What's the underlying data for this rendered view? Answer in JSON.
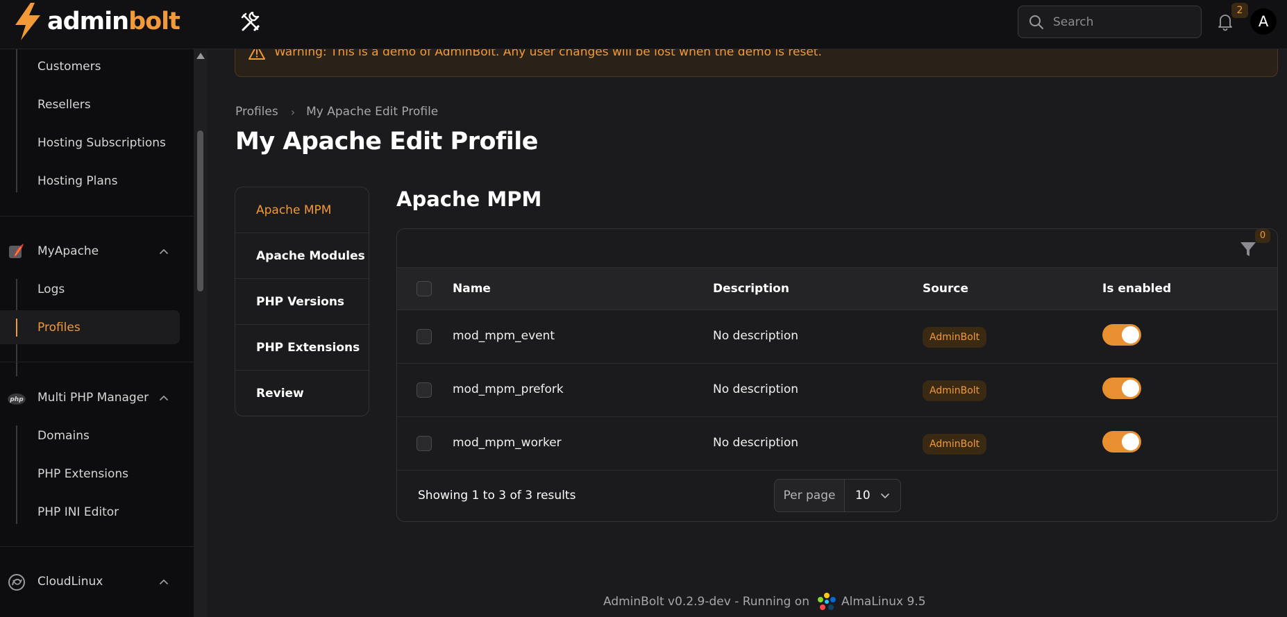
{
  "topbar": {
    "logo_part1": "admin",
    "logo_part2": "bolt",
    "search_placeholder": "Search",
    "notification_count": "2",
    "avatar_initial": "A"
  },
  "sidebar": {
    "items_top": [
      {
        "label": "Customers"
      },
      {
        "label": "Resellers"
      },
      {
        "label": "Hosting Subscriptions"
      },
      {
        "label": "Hosting Plans"
      }
    ],
    "group_myapache": {
      "label": "MyApache",
      "items": [
        {
          "label": "Logs"
        },
        {
          "label": "Profiles",
          "active": true
        }
      ]
    },
    "group_multiphp": {
      "label": "Multi PHP Manager",
      "items": [
        {
          "label": "Domains"
        },
        {
          "label": "PHP Extensions"
        },
        {
          "label": "PHP INI Editor"
        }
      ]
    },
    "group_cloudlinux": {
      "label": "CloudLinux"
    }
  },
  "warning": {
    "text": "Warning: This is a demo of AdminBolt. Any user changes will be lost when the demo is reset."
  },
  "breadcrumb": {
    "items": [
      "Profiles",
      "My Apache Edit Profile"
    ]
  },
  "page": {
    "title": "My Apache Edit Profile",
    "section_title": "Apache MPM"
  },
  "tabs": [
    {
      "label": "Apache MPM",
      "active": true
    },
    {
      "label": "Apache Modules"
    },
    {
      "label": "PHP Versions"
    },
    {
      "label": "PHP Extensions"
    },
    {
      "label": "Review"
    }
  ],
  "table": {
    "filter_count": "0",
    "columns": {
      "name": "Name",
      "description": "Description",
      "source": "Source",
      "enabled": "Is enabled"
    },
    "rows": [
      {
        "name": "mod_mpm_event",
        "description": "No description",
        "source": "AdminBolt",
        "enabled": true
      },
      {
        "name": "mod_mpm_prefork",
        "description": "No description",
        "source": "AdminBolt",
        "enabled": true
      },
      {
        "name": "mod_mpm_worker",
        "description": "No description",
        "source": "AdminBolt",
        "enabled": true
      }
    ],
    "results_text": "Showing 1 to 3 of 3 results",
    "per_page_label": "Per page",
    "per_page_value": "10"
  },
  "footer": {
    "prefix": "AdminBolt v0.2.9-dev - Running on",
    "os": "AlmaLinux 9.5"
  },
  "colors": {
    "accent": "#f29a38",
    "background": "#1b1b1d",
    "sidebar": "#0d0d0f"
  }
}
